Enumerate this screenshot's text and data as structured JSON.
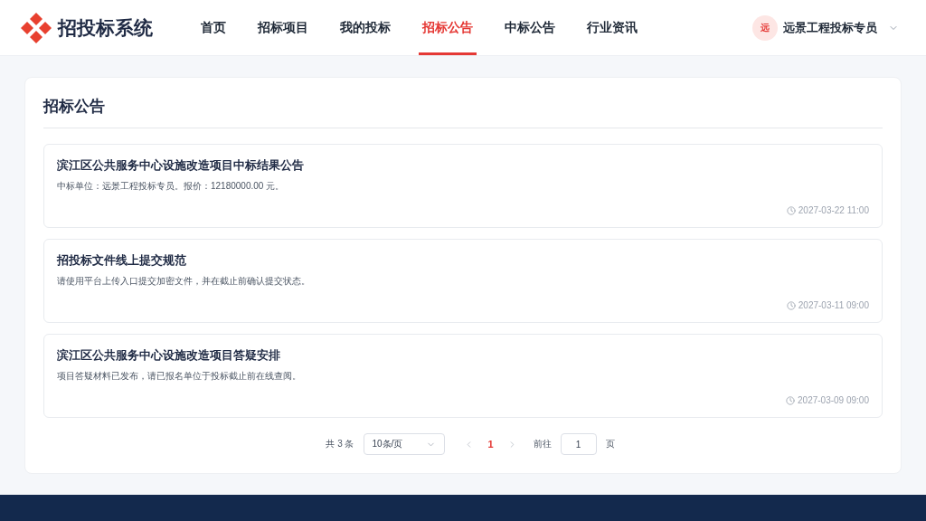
{
  "header": {
    "logo_title": "招投标系统",
    "nav": [
      {
        "label": "首页",
        "selected": false
      },
      {
        "label": "招标项目",
        "selected": false
      },
      {
        "label": "我的投标",
        "selected": false
      },
      {
        "label": "招标公告",
        "selected": true
      },
      {
        "label": "中标公告",
        "selected": false
      },
      {
        "label": "行业资讯",
        "selected": false
      }
    ],
    "user": {
      "avatar": "远",
      "name": "远景工程投标专员"
    }
  },
  "page": {
    "title": "招标公告"
  },
  "notices": [
    {
      "title": "滨江区公共服务中心设施改造项目中标结果公告",
      "summary": "中标单位：远景工程投标专员。报价：12180000.00 元。",
      "time": "2027-03-22 11:00"
    },
    {
      "title": "招投标文件线上提交规范",
      "summary": "请使用平台上传入口提交加密文件，并在截止前确认提交状态。",
      "time": "2027-03-11 09:00"
    },
    {
      "title": "滨江区公共服务中心设施改造项目答疑安排",
      "summary": "项目答疑材料已发布，请已报名单位于投标截止前在线查阅。",
      "time": "2027-03-09 09:00"
    }
  ],
  "pagination": {
    "total": "共 3 条",
    "page_size": "10条/页",
    "prev": {
      "disabled": true
    },
    "pages": [
      {
        "label": "1",
        "selected": true
      }
    ],
    "next": {
      "disabled": true
    },
    "goto_label": "前往",
    "goto_value": "1",
    "goto_suffix": "页"
  }
}
